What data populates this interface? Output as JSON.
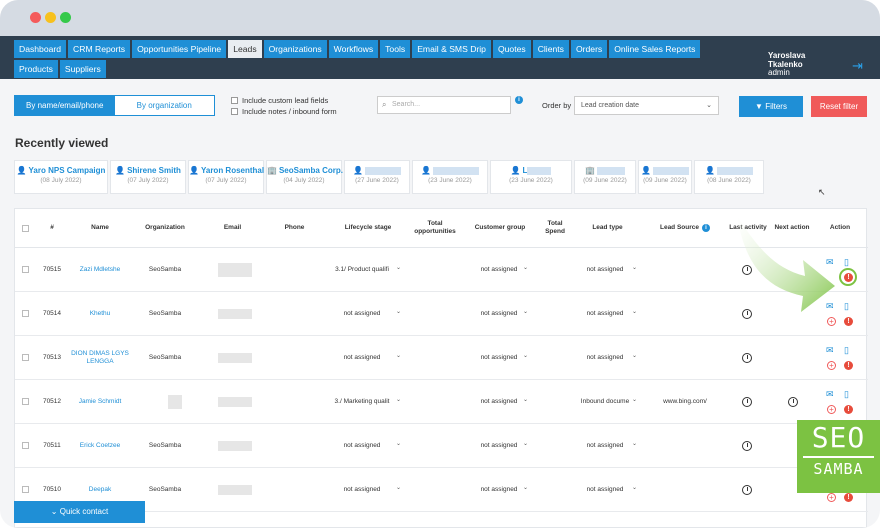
{
  "nav": {
    "items": [
      "Dashboard",
      "CRM Reports",
      "Opportunities Pipeline",
      "Leads",
      "Organizations",
      "Workflows",
      "Tools",
      "Email & SMS Drip",
      "Quotes",
      "Clients",
      "Orders",
      "Online Sales Reports",
      "Products",
      "Suppliers"
    ],
    "active": "Leads",
    "user_name_1": "Yaroslava",
    "user_name_2": "Tkalenko",
    "user_role": "admin"
  },
  "filters": {
    "toggle_left": "By name/email/phone",
    "toggle_right": "By organization",
    "check1": "Include custom lead fields",
    "check2": "Include notes / inbound form",
    "search_placeholder": "Search...",
    "order_by_label": "Order by",
    "order_by_value": "Lead creation date",
    "filters_button": "Filters",
    "reset_button": "Reset filter"
  },
  "recently_viewed": {
    "title": "Recently viewed",
    "cards": [
      {
        "name": "Yaro NPS Campaign",
        "date": "(08 July 2022)",
        "icon": "user-icon"
      },
      {
        "name": "Shirene Smith",
        "date": "(07 July 2022)",
        "icon": "user-icon"
      },
      {
        "name": "Yaron Rosenthal",
        "date": "(07 July 2022)",
        "icon": "user-icon"
      },
      {
        "name": "SeoSamba Corp.",
        "date": "(04 July 2022)",
        "icon": "building-icon"
      },
      {
        "name": "",
        "date": "(27 June 2022)",
        "icon": "user-icon"
      },
      {
        "name": "",
        "date": "(23 June 2022)",
        "icon": "user-icon"
      },
      {
        "name": "L",
        "date": "(23 June 2022)",
        "icon": "user-icon"
      },
      {
        "name": "",
        "date": "(09 June 2022)",
        "icon": "building-icon"
      },
      {
        "name": "",
        "date": "(09 June 2022)",
        "icon": "user-icon"
      },
      {
        "name": "",
        "date": "(08 June 2022)",
        "icon": "user-icon"
      }
    ]
  },
  "table": {
    "headers": {
      "id": "#",
      "name": "Name",
      "org": "Organization",
      "email": "Email",
      "phone": "Phone",
      "lifecycle": "Lifecycle stage",
      "total_opp": "Total opportunities",
      "group": "Customer group",
      "spend": "Total Spend",
      "type": "Lead type",
      "source": "Lead Source",
      "activity": "Last activity",
      "next": "Next action",
      "action": "Action"
    },
    "rows": [
      {
        "id": "70515",
        "name": "Zazi Mdletshe",
        "org": "SeoSamba",
        "lifecycle": "3.1/ Product qualifi",
        "group": "not assigned",
        "type": "not assigned",
        "source": ""
      },
      {
        "id": "70514",
        "name": "Khethu",
        "org": "SeoSamba",
        "lifecycle": "not assigned",
        "group": "not assigned",
        "type": "not assigned",
        "source": ""
      },
      {
        "id": "70513",
        "name": "DION DIMAS LGYS LENGGA",
        "org": "SeoSamba",
        "lifecycle": "not assigned",
        "group": "not assigned",
        "type": "not assigned",
        "source": ""
      },
      {
        "id": "70512",
        "name": "Jamie Schmidt",
        "org": "",
        "lifecycle": "3./ Marketing qualit",
        "group": "not assigned",
        "type": "Inbound docume",
        "source": "www.bing.com/"
      },
      {
        "id": "70511",
        "name": "Erick Coetzee",
        "org": "SeoSamba",
        "lifecycle": "not assigned",
        "group": "not assigned",
        "type": "not assigned",
        "source": ""
      },
      {
        "id": "70510",
        "name": "Deepak",
        "org": "SeoSamba",
        "lifecycle": "not assigned",
        "group": "not assigned",
        "type": "not assigned",
        "source": ""
      }
    ]
  },
  "quick_contact": "Quick contact",
  "badge": {
    "line1": "SEO",
    "line2": "SAMBA"
  },
  "colors": {
    "brand_blue": "#1f8fd6",
    "nav_bg": "#2f3f4f",
    "reset_red": "#f05a5a",
    "seo_green": "#7cc242"
  }
}
